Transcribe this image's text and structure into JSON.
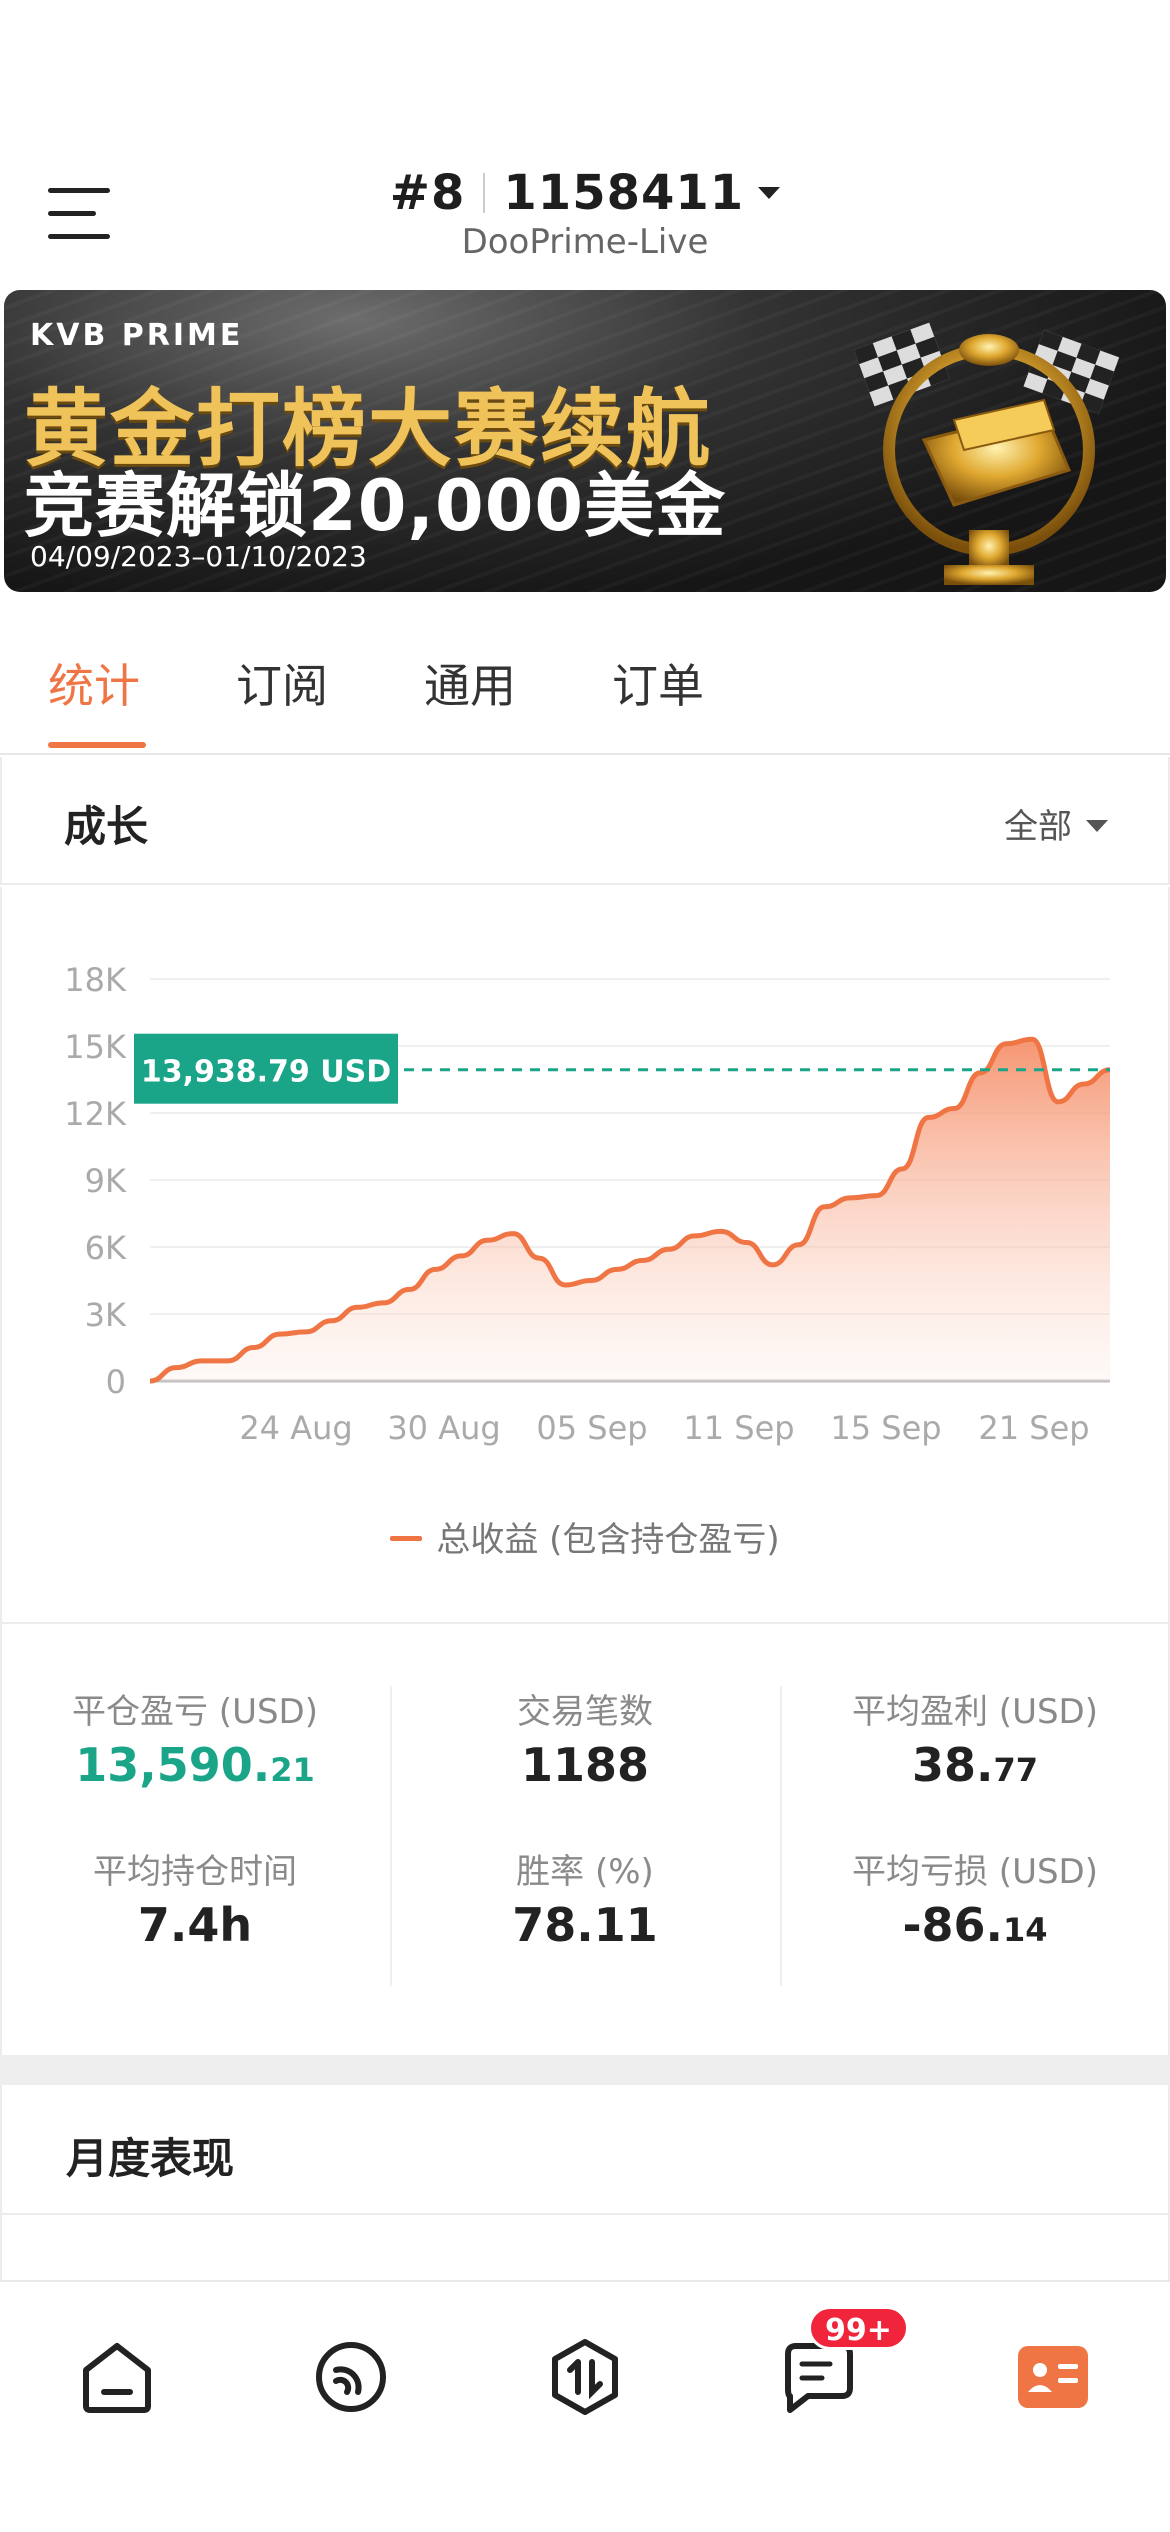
{
  "header": {
    "rank": "#8",
    "account": "1158411",
    "server": "DooPrime-Live"
  },
  "banner": {
    "brand": "KVB PRIME",
    "title": "黄金打榜大赛续航",
    "subtitle": "竞赛解锁20,000美金",
    "dates": "04/09/2023–01/10/2023"
  },
  "tabs": [
    {
      "label": "统计",
      "active": true
    },
    {
      "label": "订阅",
      "active": false
    },
    {
      "label": "通用",
      "active": false
    },
    {
      "label": "订单",
      "active": false
    }
  ],
  "growth": {
    "title": "成长",
    "filter": "全部"
  },
  "chart_data": {
    "type": "area",
    "y_ticks": [
      "18K",
      "15K",
      "12K",
      "9K",
      "6K",
      "3K",
      "0"
    ],
    "x_ticks": [
      "24 Aug",
      "30 Aug",
      "05 Sep",
      "11 Sep",
      "15 Sep",
      "21 Sep"
    ],
    "ylim": [
      0,
      18000
    ],
    "grid": true,
    "series": [
      {
        "name": "总收益 (包含持仓盈亏)",
        "color": "#f07545",
        "values": [
          0,
          600,
          900,
          900,
          1500,
          2100,
          2200,
          2700,
          3300,
          3500,
          4100,
          5000,
          5600,
          6300,
          6600,
          5500,
          4300,
          4500,
          5000,
          5400,
          5900,
          6500,
          6700,
          6200,
          5200,
          6100,
          7800,
          8200,
          8300,
          9500,
          11800,
          12200,
          13800,
          15100,
          15300,
          12500,
          13300,
          13939
        ]
      }
    ],
    "reference_line": {
      "value": 13938.79,
      "label": "13,938.79 USD",
      "color": "#1aa589"
    }
  },
  "stats": {
    "closed_pnl_label": "平仓盈亏 (USD)",
    "closed_pnl_int": "13,590.",
    "closed_pnl_dec": "21",
    "trades_label": "交易笔数",
    "trades_value": "1188",
    "avg_profit_label": "平均盈利 (USD)",
    "avg_profit_int": "38.",
    "avg_profit_dec": "77",
    "avg_hold_label": "平均持仓时间",
    "avg_hold_value": "7.4h",
    "win_rate_label": "胜率 (%)",
    "win_rate_value": "78.11",
    "avg_loss_label": "平均亏损 (USD)",
    "avg_loss_int": "-86.",
    "avg_loss_dec": "14"
  },
  "monthly": {
    "title": "月度表现"
  },
  "bottom_nav": {
    "badge": "99+",
    "items": [
      "home-icon",
      "signal-icon",
      "trade-icon",
      "message-icon",
      "profile-icon"
    ],
    "active_color": "#f07545"
  }
}
